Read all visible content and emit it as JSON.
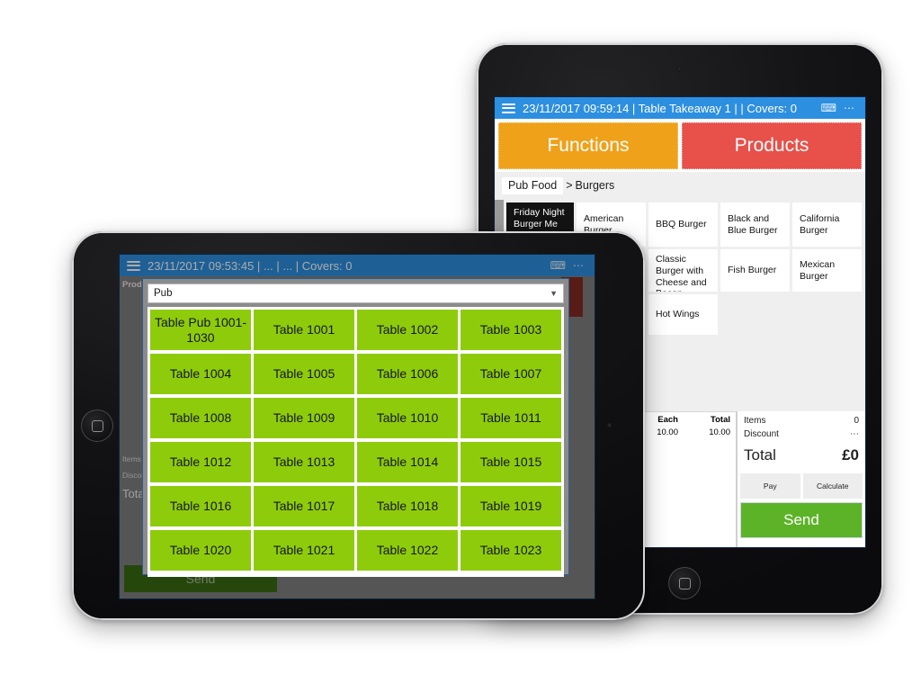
{
  "right_tablet": {
    "titlebar": {
      "menu_icon": "hamburger-icon",
      "text": "23/11/2017 09:59:14 | Table Takeaway 1 |  | Covers: 0",
      "keyboard_icon": "⌨",
      "overflow_icon": "⋯"
    },
    "modes": {
      "functions": "Functions",
      "products": "Products"
    },
    "breadcrumb": {
      "current": "Pub Food",
      "separator": ">",
      "child": "Burgers"
    },
    "products": [
      [
        "Friday Night Burger Me Classic",
        "American Burger",
        "BBQ Burger",
        "Black and Blue Burger",
        "California Burger"
      ],
      [
        "",
        "",
        "Classic Burger with Cheese and Bacon",
        "Fish Burger",
        "Mexican Burger"
      ],
      [
        "",
        "",
        "Hot Wings",
        "",
        ""
      ]
    ],
    "selected_product": "Friday Night Burger Me Classic",
    "order_columns": {
      "each": "Each",
      "total": "Total"
    },
    "order_values": {
      "each": "10.00",
      "total": "10.00"
    },
    "totals": {
      "items_label": "Items",
      "items_value": "0",
      "discount_label": "Discount",
      "discount_value": "⋯",
      "total_label": "Total",
      "total_value": "£0"
    },
    "actions": {
      "pay": "Pay",
      "calculate": "Calculate",
      "send": "Send"
    }
  },
  "left_tablet": {
    "titlebar": {
      "menu_icon": "hamburger-icon",
      "text": "23/11/2017 09:53:45 | ... | ... | Covers: 0",
      "keyboard_icon": "⌨",
      "overflow_icon": "⋯"
    },
    "behind_label": "Produ",
    "summary_stubs": {
      "items": "Items",
      "discount": "Discou",
      "total": "Tota"
    },
    "send_label": "Send",
    "modal": {
      "dropdown_value": "Pub",
      "dropdown_caret": "chevron-down-icon",
      "tables": [
        [
          "Table Pub 1001-1030",
          "Table 1001",
          "Table 1002",
          "Table 1003"
        ],
        [
          "Table 1004",
          "Table 1005",
          "Table 1006",
          "Table 1007"
        ],
        [
          "Table 1008",
          "Table 1009",
          "Table 1010",
          "Table 1011"
        ],
        [
          "Table 1012",
          "Table 1013",
          "Table 1014",
          "Table 1015"
        ],
        [
          "Table 1016",
          "Table 1017",
          "Table 1018",
          "Table 1019"
        ],
        [
          "Table 1020",
          "Table 1021",
          "Table 1022",
          "Table 1023"
        ]
      ]
    }
  },
  "colors": {
    "title_blue": "#2d8fe0",
    "functions_orange": "#f0a11a",
    "products_red": "#e8504a",
    "table_green": "#8ecc0b",
    "send_green": "#5cb327",
    "dark_red": "#832a22",
    "modal_grey": "#8b8b8b"
  }
}
